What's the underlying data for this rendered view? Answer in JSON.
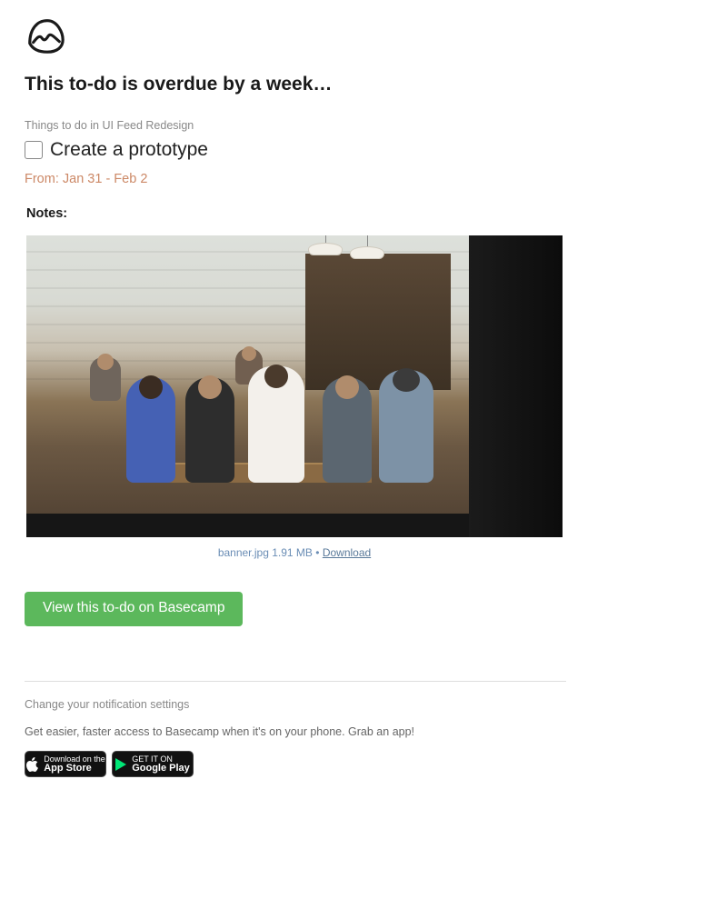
{
  "header": {
    "title": "This to-do is overdue by a week…"
  },
  "breadcrumb": "Things to do in UI Feed Redesign",
  "todo": {
    "title": "Create a prototype",
    "date_range": "From: Jan 31 - Feb 2"
  },
  "notes": {
    "label": "Notes:"
  },
  "attachment": {
    "filename": "banner.jpg",
    "filesize": "1.91 MB",
    "separator": " • ",
    "download_label": "Download"
  },
  "cta": {
    "label": "View this to-do on Basecamp"
  },
  "footer": {
    "settings_link": "Change your notification settings",
    "promo_text": "Get easier, faster access to Basecamp when it's on your phone. Grab an app!",
    "appstore": {
      "top": "Download on the",
      "bottom": "App Store"
    },
    "googleplay": {
      "top": "GET IT ON",
      "bottom": "Google Play"
    }
  }
}
